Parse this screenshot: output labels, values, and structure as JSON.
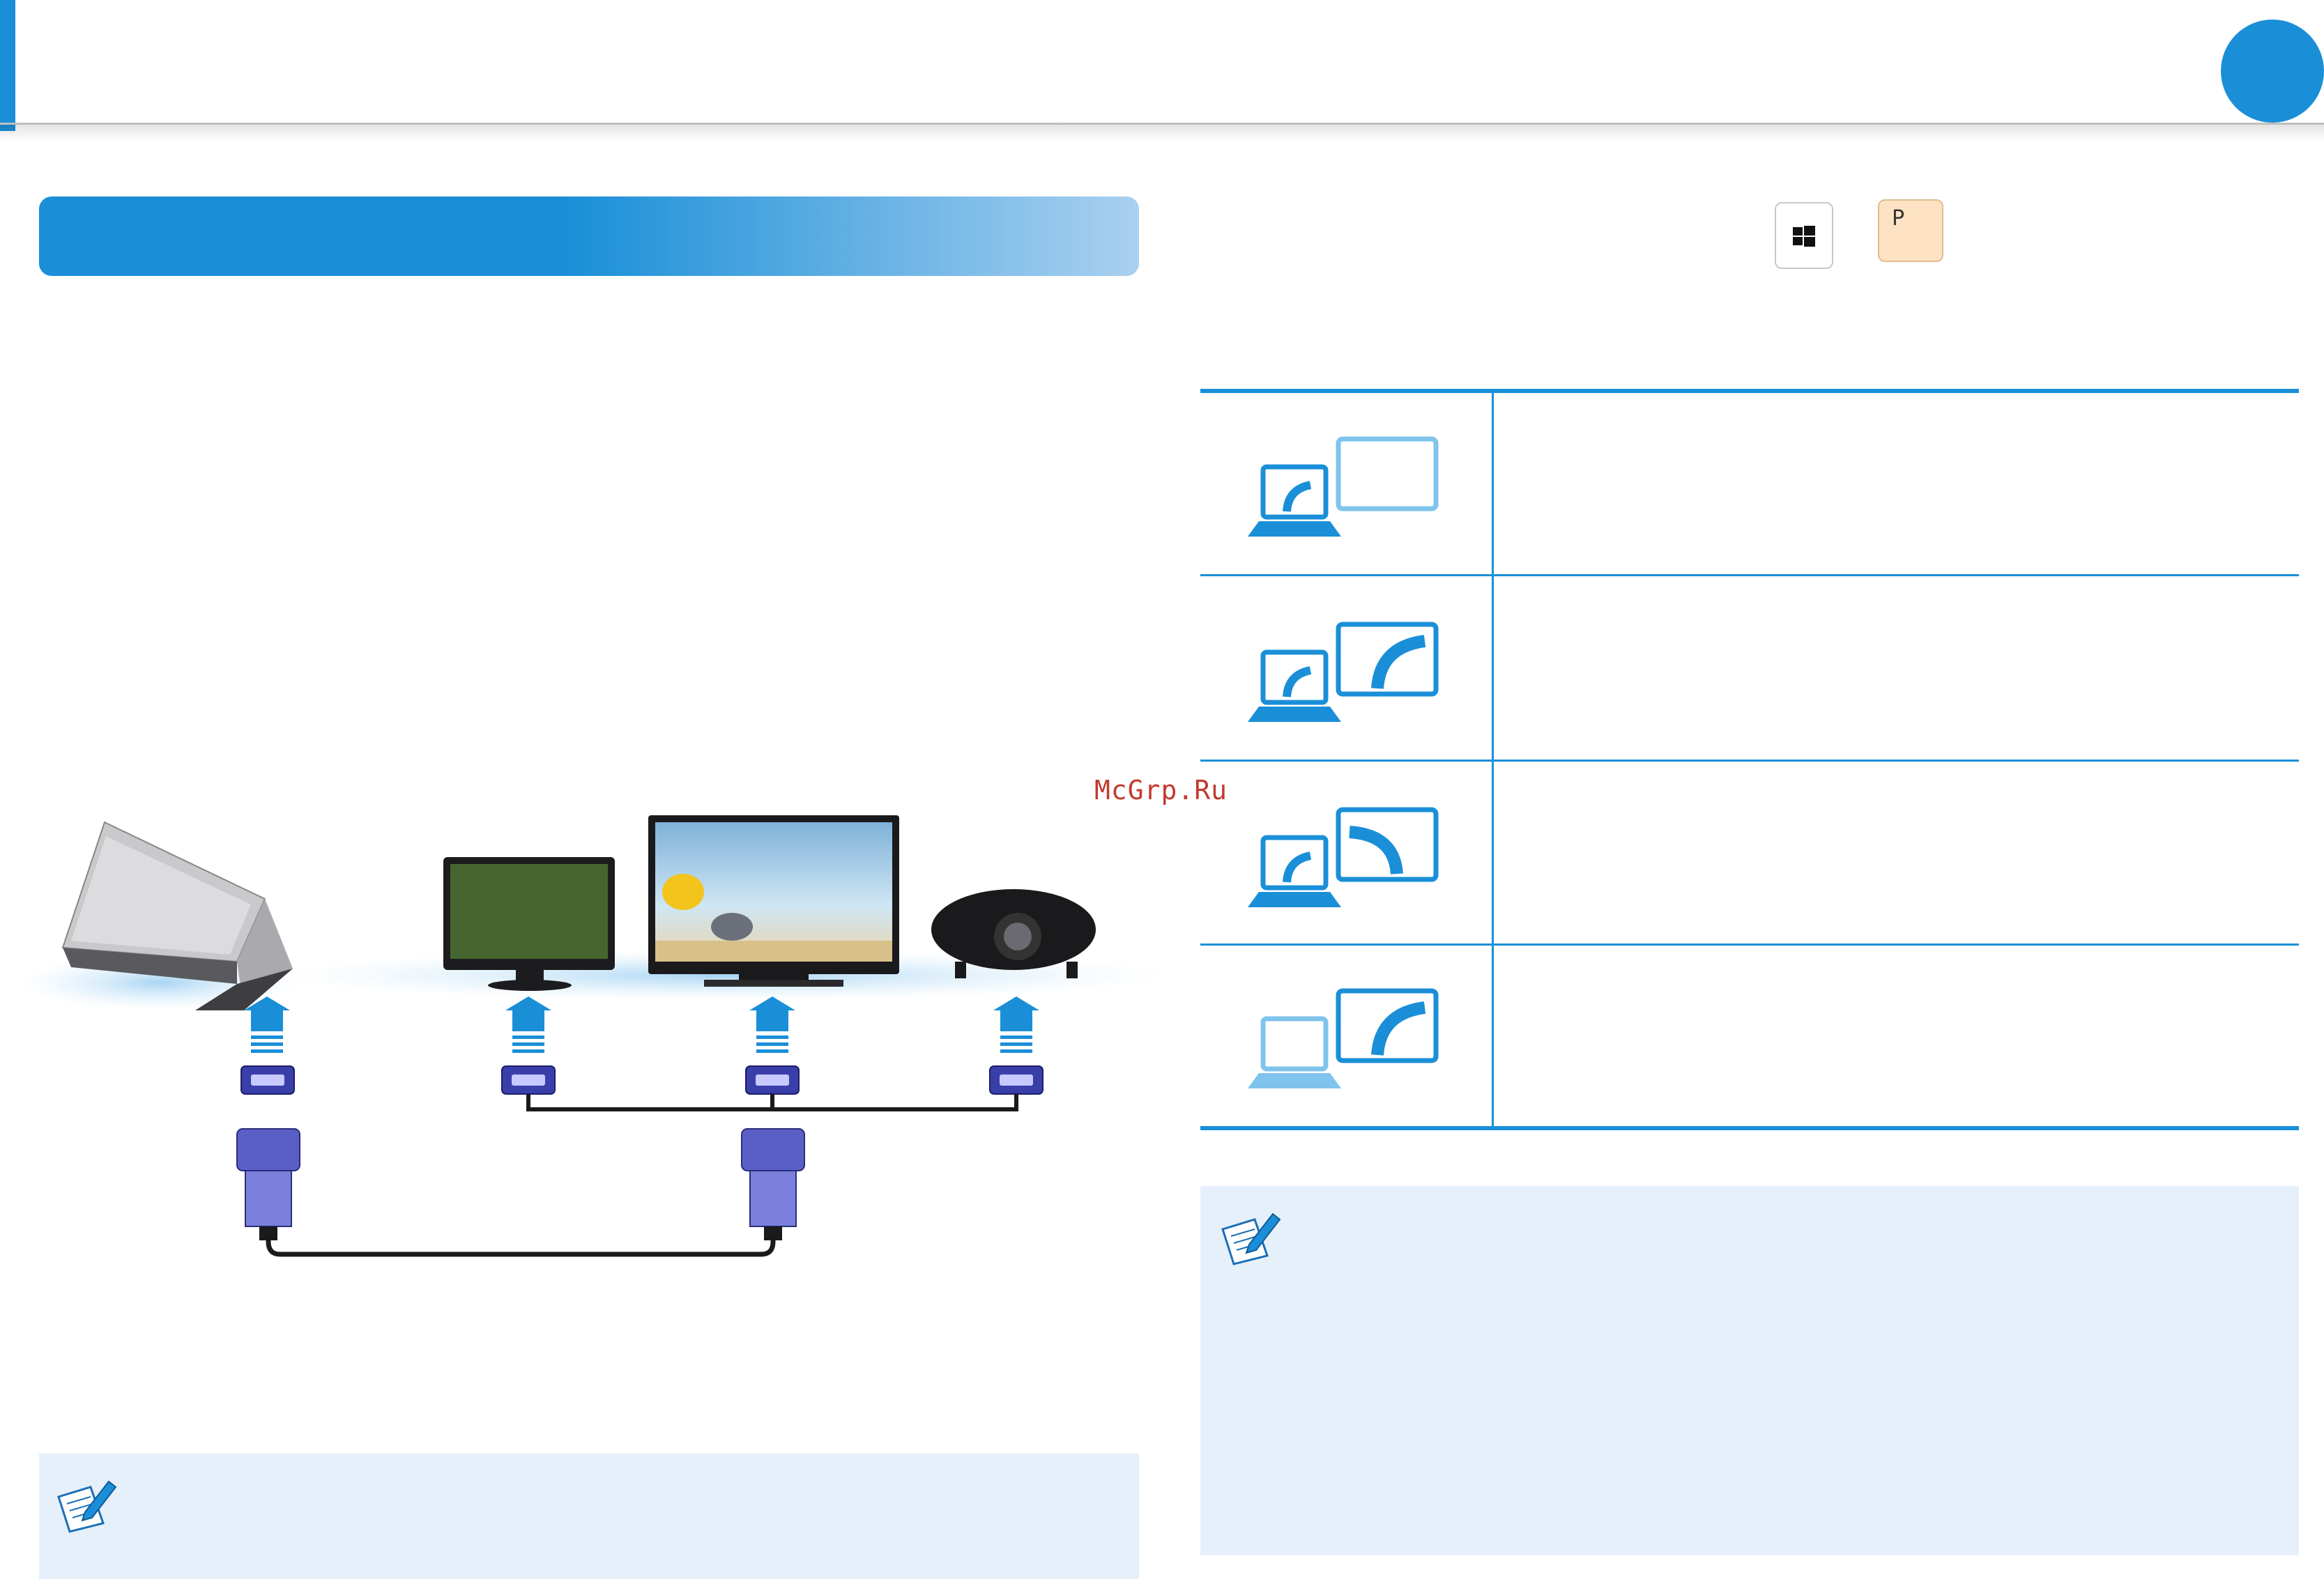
{
  "keys": {
    "win": "win-logo-icon",
    "p": "P"
  },
  "watermark": "McGrp.Ru",
  "icons": {
    "note": "note-pencil-icon",
    "modes": [
      "pc-screen-only-icon",
      "duplicate-icon",
      "extend-icon",
      "second-screen-only-icon"
    ],
    "devices": [
      "laptop-icon",
      "monitor-icon",
      "tv-icon",
      "projector-icon"
    ],
    "connector": "vga-connector-icon",
    "arrow": "up-arrow-icon"
  },
  "colors": {
    "accent": "#1a8fd8",
    "light": "#7fc4ec",
    "note_bg": "#e6f0fa",
    "connector": "#3a3ea8"
  }
}
